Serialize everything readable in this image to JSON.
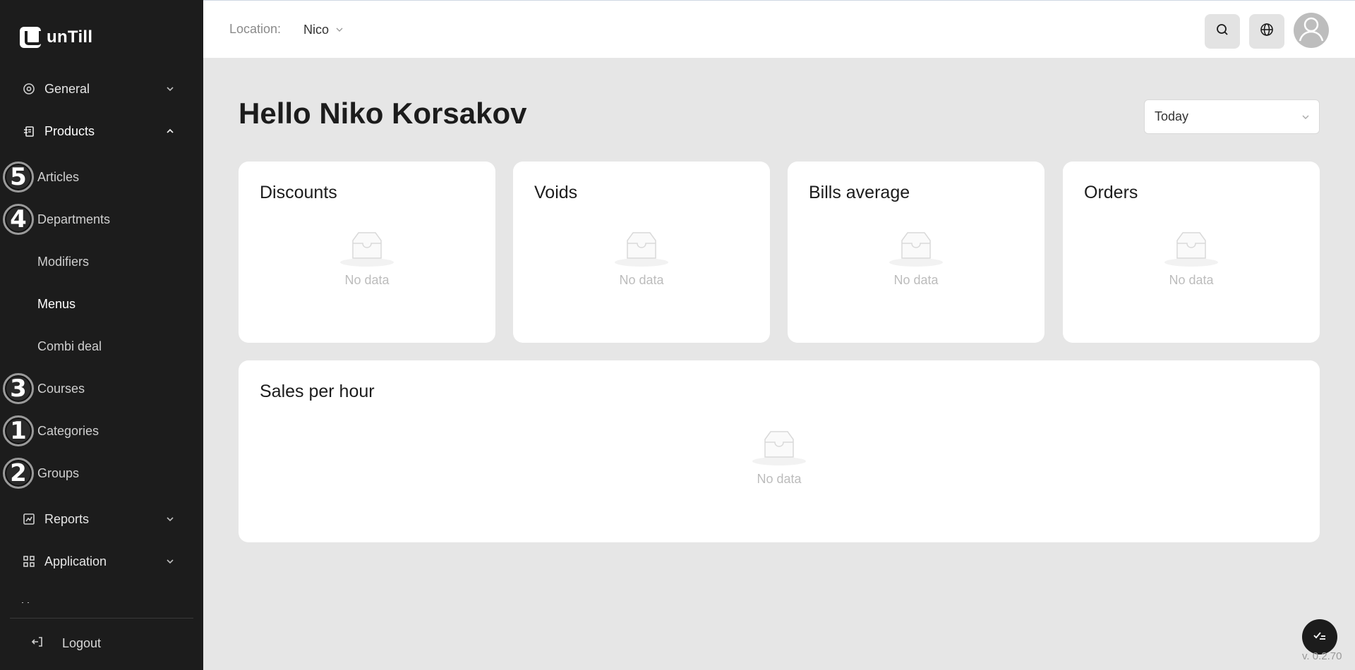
{
  "app": {
    "logo_text": "unTill"
  },
  "sidebar": {
    "general": "General",
    "products": "Products",
    "submenu": {
      "articles": "Articles",
      "departments": "Departments",
      "modifiers": "Modifiers",
      "menus": "Menus",
      "combi_deal": "Combi deal",
      "courses": "Courses",
      "categories": "Categories",
      "groups": "Groups"
    },
    "badges": {
      "articles": "5",
      "departments": "4",
      "courses": "3",
      "categories": "1",
      "groups": "2"
    },
    "reports": "Reports",
    "application": "Application",
    "logout": "Logout"
  },
  "topbar": {
    "location_label": "Location:",
    "location_value": "Nico"
  },
  "main": {
    "greeting": "Hello Niko Korsakov",
    "period": "Today",
    "cards": {
      "discounts": "Discounts",
      "voids": "Voids",
      "bills_average": "Bills average",
      "orders": "Orders",
      "sales_per_hour": "Sales per hour"
    },
    "no_data": "No data"
  },
  "footer": {
    "version": "v. 0.2.70"
  }
}
